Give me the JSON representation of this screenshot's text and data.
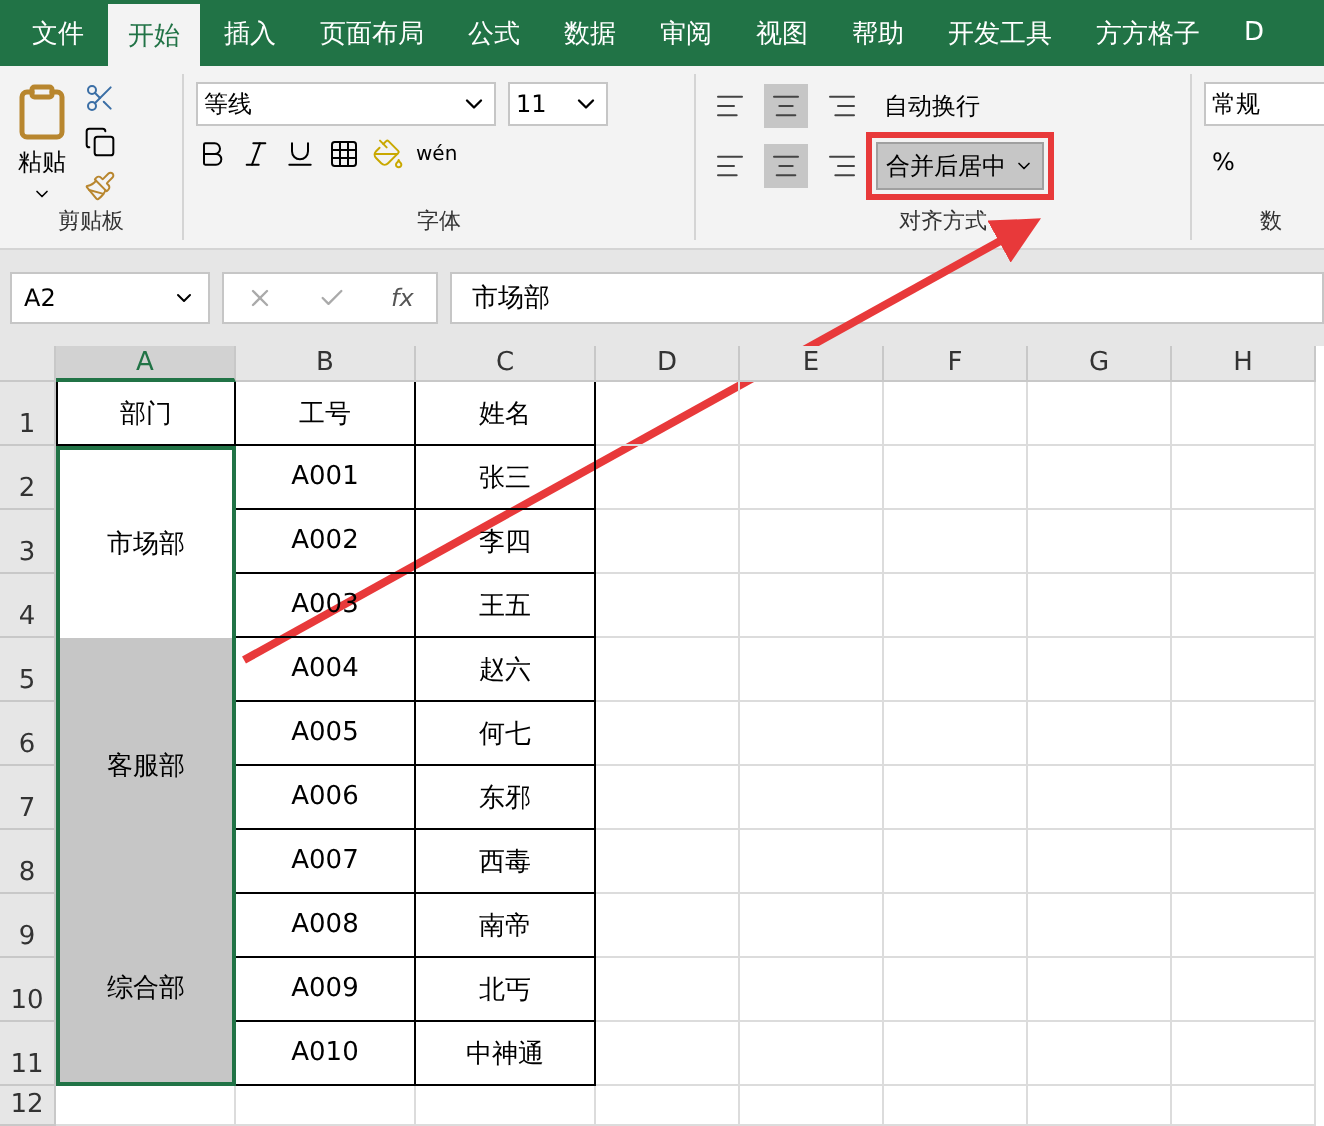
{
  "tabs": [
    {
      "label": "文件",
      "selected": false
    },
    {
      "label": "开始",
      "selected": true
    },
    {
      "label": "插入",
      "selected": false
    },
    {
      "label": "页面布局",
      "selected": false
    },
    {
      "label": "公式",
      "selected": false
    },
    {
      "label": "数据",
      "selected": false
    },
    {
      "label": "审阅",
      "selected": false
    },
    {
      "label": "视图",
      "selected": false
    },
    {
      "label": "帮助",
      "selected": false
    },
    {
      "label": "开发工具",
      "selected": false
    },
    {
      "label": "方方格子",
      "selected": false
    },
    {
      "label": "D",
      "selected": false
    }
  ],
  "ribbon": {
    "paste_label": "粘贴",
    "font_name": "等线",
    "font_size": "11",
    "wrap_text": "自动换行",
    "merge_center": "合并后居中",
    "number_format": "常规",
    "percent": "%",
    "phonetic": "wén",
    "groups": [
      "剪贴板",
      "字体",
      "对齐方式",
      "数"
    ]
  },
  "formula_bar": {
    "name_box": "A2",
    "fx_label": "fx",
    "formula": "市场部"
  },
  "columns": [
    "A",
    "B",
    "C",
    "D",
    "E",
    "F",
    "G",
    "H"
  ],
  "row_numbers": [
    "1",
    "2",
    "3",
    "4",
    "5",
    "6",
    "7",
    "8",
    "9",
    "10",
    "11",
    "12"
  ],
  "header": [
    "部门",
    "工号",
    "姓名"
  ],
  "departments": [
    {
      "name": "市场部",
      "active": true,
      "records": [
        {
          "id": "A001",
          "name": "张三"
        },
        {
          "id": "A002",
          "name": "李四"
        },
        {
          "id": "A003",
          "name": "王五"
        }
      ]
    },
    {
      "name": "客服部",
      "active": false,
      "records": [
        {
          "id": "A004",
          "name": "赵六"
        },
        {
          "id": "A005",
          "name": "何七"
        },
        {
          "id": "A006",
          "name": "东邪"
        },
        {
          "id": "A007",
          "name": "西毒"
        }
      ]
    },
    {
      "name": "综合部",
      "active": false,
      "records": [
        {
          "id": "A008",
          "name": "南帝"
        },
        {
          "id": "A009",
          "name": "北丐"
        },
        {
          "id": "A010",
          "name": "中神通"
        }
      ]
    }
  ]
}
